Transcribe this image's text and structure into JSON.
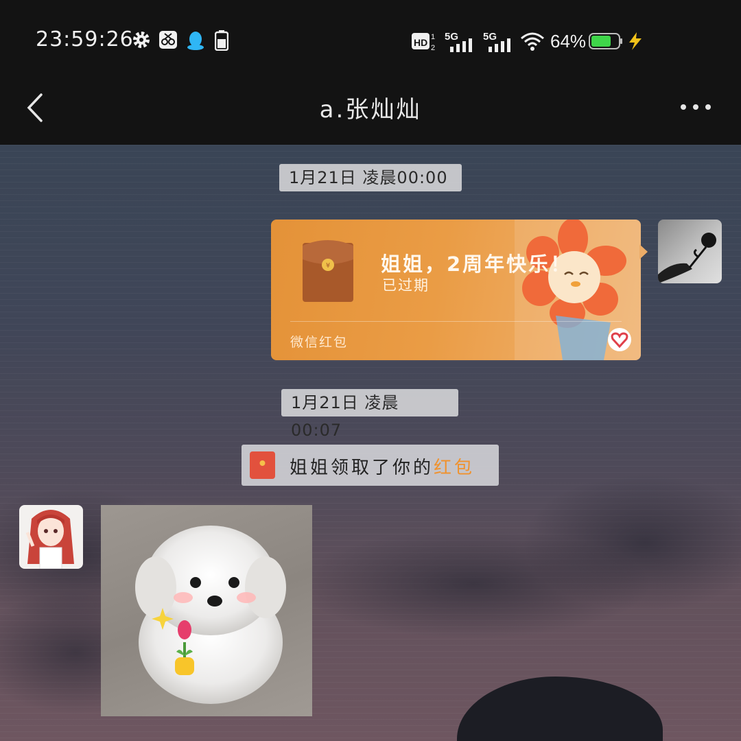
{
  "status_bar": {
    "time": "23:59:26",
    "battery_percent": "64%",
    "network_1": "5G",
    "network_2": "5G",
    "hd_label": "HD",
    "icons": [
      "gear-icon",
      "scissors-icon",
      "qq-penguin-icon",
      "battery-small-icon",
      "hd-icon",
      "signal-icon",
      "signal-icon",
      "wifi-icon",
      "battery-icon",
      "charging-icon"
    ]
  },
  "header": {
    "title": "a.张灿灿",
    "back_icon": "chevron-left-icon",
    "more_icon": "more-dots-icon"
  },
  "messages": [
    {
      "type": "timestamp",
      "text": "1月21日 凌晨00:00"
    },
    {
      "type": "red_packet",
      "sender": "me",
      "title": "姐姐，2周年快乐！",
      "status": "已过期",
      "footer": "微信红包"
    },
    {
      "type": "timestamp",
      "text": "1月21日 凌晨00:07"
    },
    {
      "type": "system",
      "text": "姐姐领取了你的",
      "link": "红包"
    },
    {
      "type": "image",
      "sender": "other",
      "alt": "puppy holding a tulip"
    }
  ],
  "colors": {
    "red_packet": "#ea9c45",
    "link_orange": "#f0922e",
    "topbar": "#131313"
  }
}
